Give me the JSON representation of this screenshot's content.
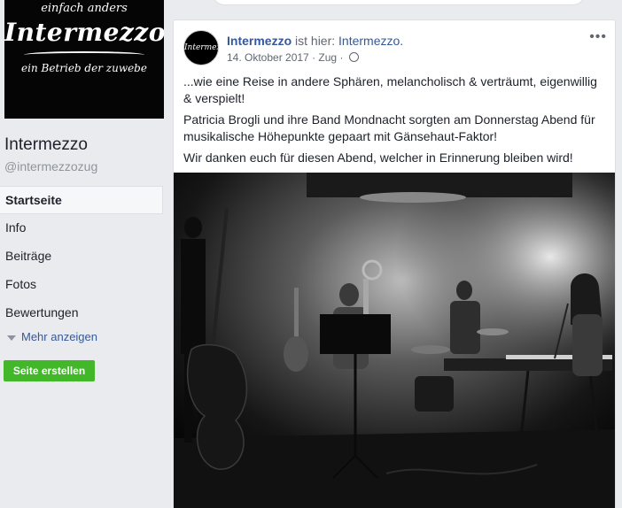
{
  "cover": {
    "logo_top": "einfach anders",
    "logo_main": "Intermezzo",
    "logo_sub": "ein Betrieb der zuwebe"
  },
  "page": {
    "name": "Intermezzo",
    "handle": "@intermezzozug"
  },
  "nav": {
    "items": [
      {
        "label": "Startseite",
        "active": true
      },
      {
        "label": "Info"
      },
      {
        "label": "Beiträge"
      },
      {
        "label": "Fotos"
      },
      {
        "label": "Bewertungen"
      }
    ],
    "more_label": "Mehr anzeigen",
    "create_button": "Seite erstellen"
  },
  "post": {
    "author": "Intermezzo",
    "is_here": "ist hier:",
    "place": "Intermezzo.",
    "date": "14. Oktober 2017",
    "separator": "·",
    "location": "Zug",
    "menu": "•••",
    "paragraphs": [
      "...wie eine Reise in andere Sphären, melancholisch & verträumt, eigenwillig & verspielt!",
      "Patricia Brogli und ihre Band Mondnacht sorgten am Donnerstag Abend für musikalische Höhepunkte gepaart mit Gänsehaut-Faktor!",
      "Wir danken euch für diesen Abend, welcher in Erinnerung bleiben wird!"
    ],
    "photo_icon": "band-photo"
  }
}
